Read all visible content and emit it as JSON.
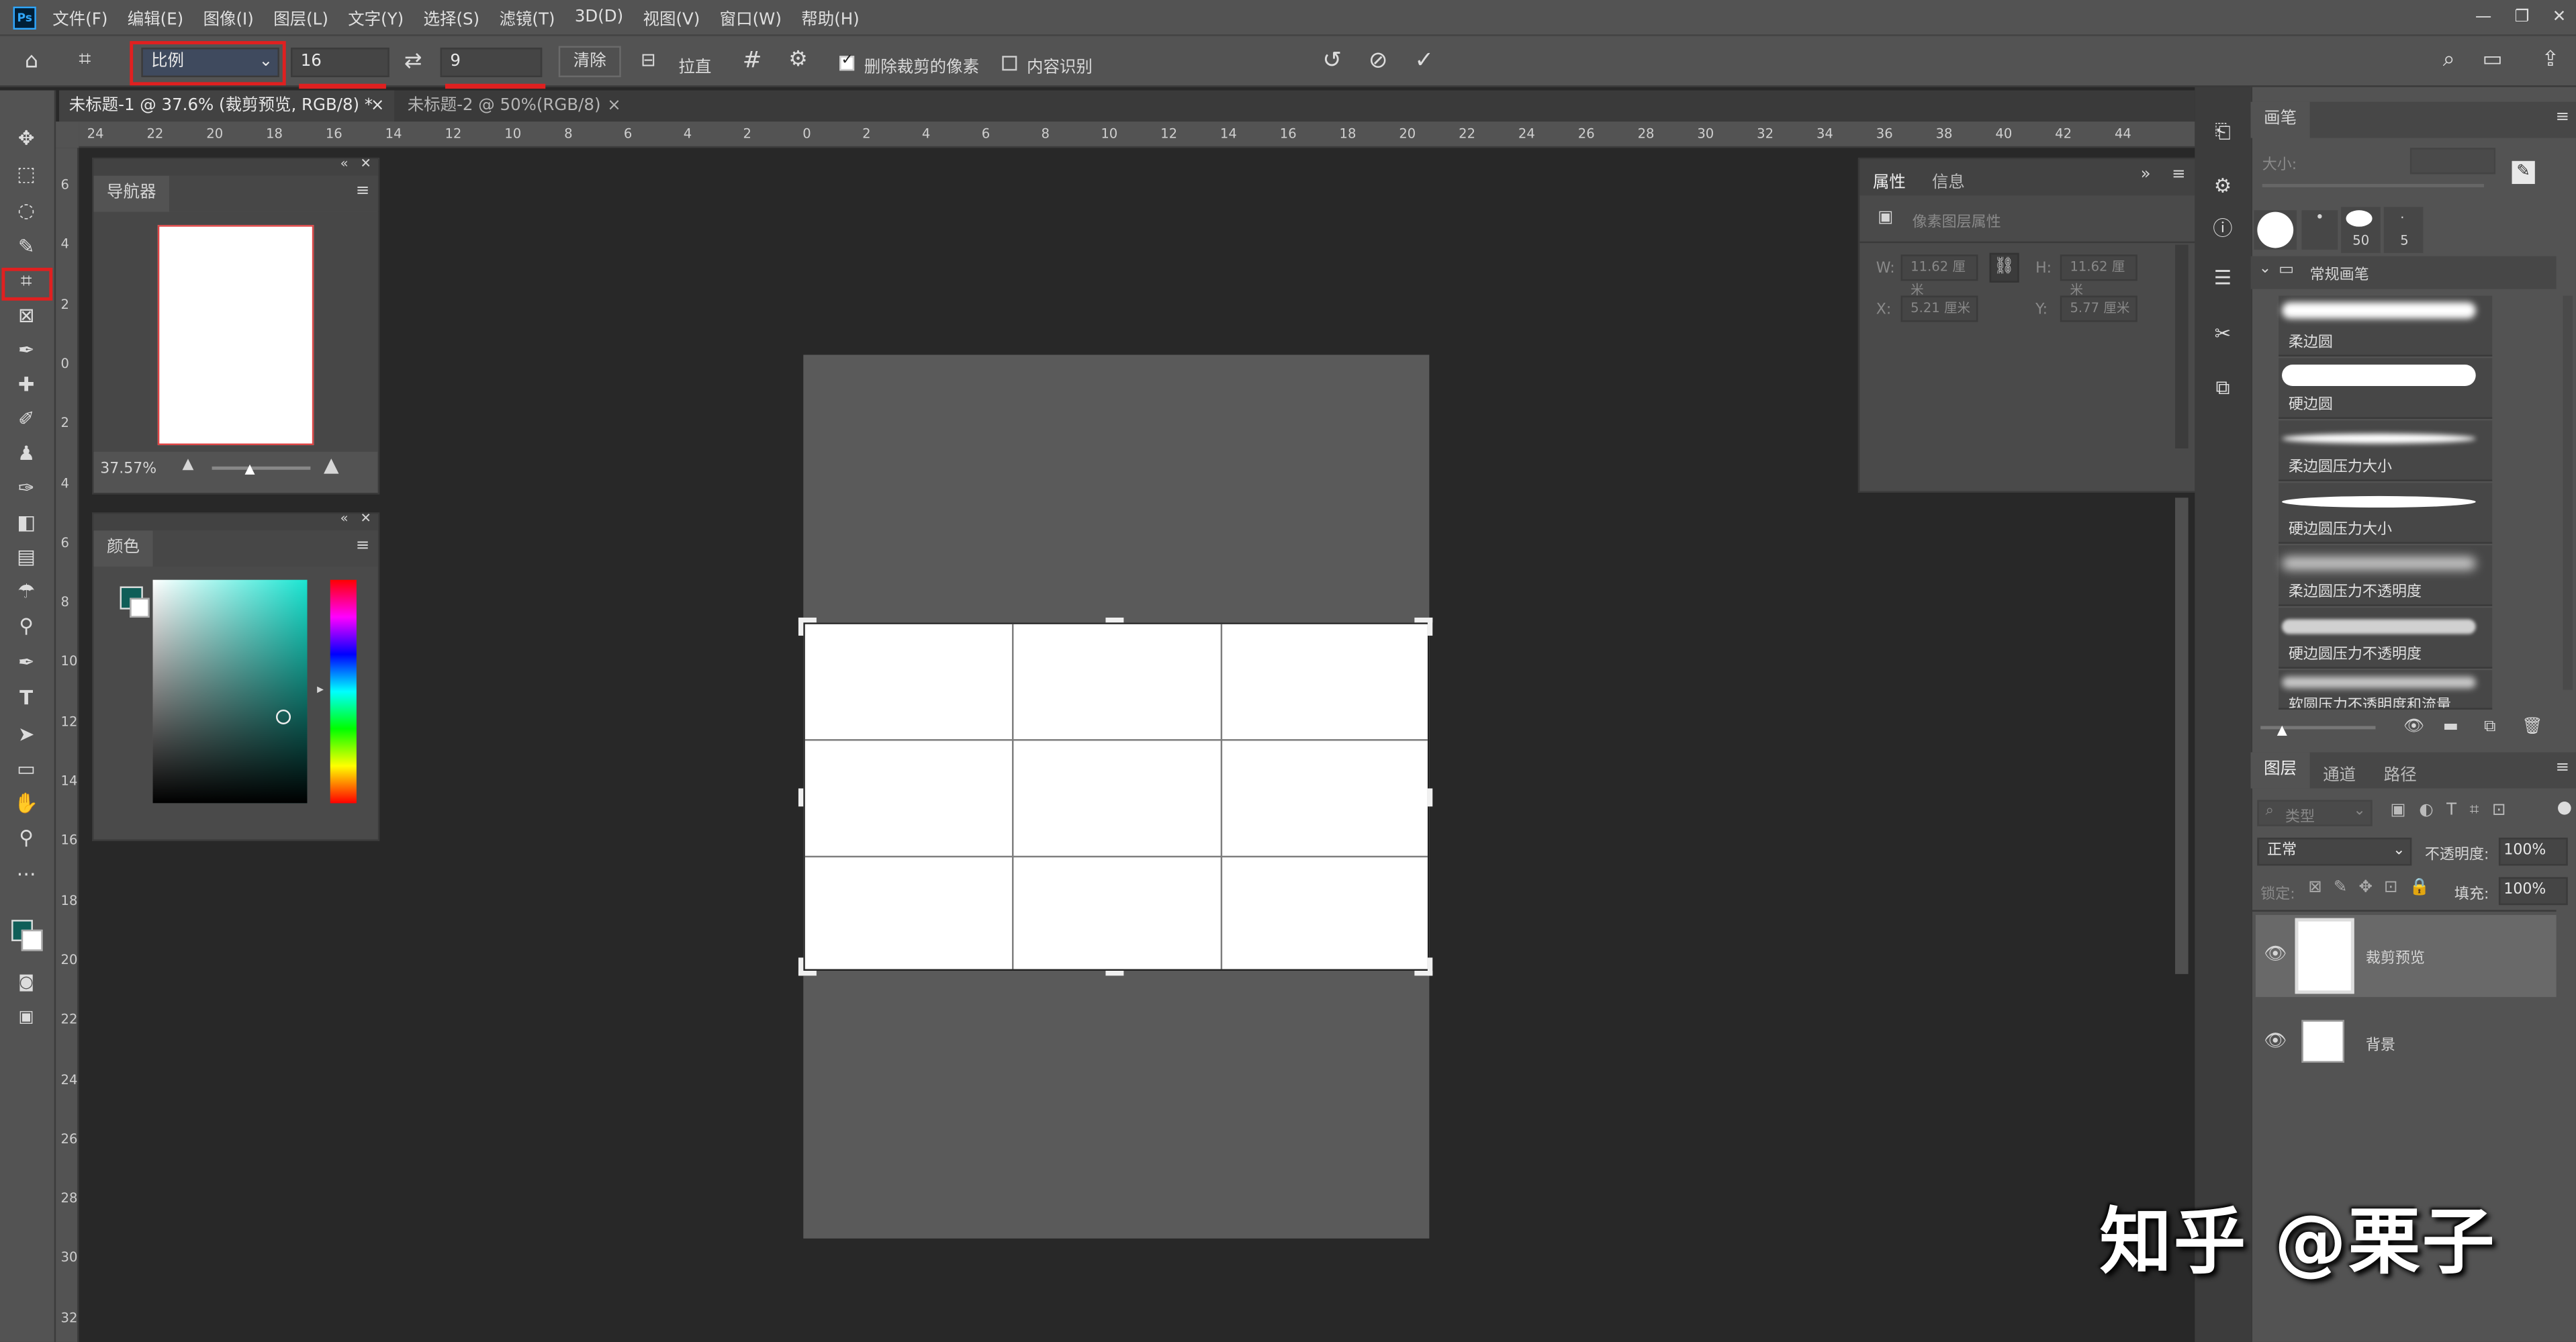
{
  "menu": {
    "logo": "Ps",
    "items": [
      "文件(F)",
      "编辑(E)",
      "图像(I)",
      "图层(L)",
      "文字(Y)",
      "选择(S)",
      "滤镜(T)",
      "3D(D)",
      "视图(V)",
      "窗口(W)",
      "帮助(H)"
    ],
    "window_controls": [
      "—",
      "❐",
      "✕"
    ]
  },
  "options": {
    "ratio_select": "比例",
    "width_value": "16",
    "height_value": "9",
    "clear_label": "清除",
    "straighten_label": "拉直",
    "delete_pixels_label": "删除裁剪的像素",
    "content_aware_label": "内容识别",
    "delete_pixels_checked": true,
    "content_aware_checked": false
  },
  "tabs": [
    {
      "label": "未标题-1 @ 37.6% (裁剪预览, RGB/8) *",
      "close": "×",
      "active": true
    },
    {
      "label": "未标题-2 @ 50%(RGB/8)",
      "close": "×",
      "active": false
    }
  ],
  "ruler_h": [
    "24",
    "22",
    "20",
    "18",
    "16",
    "14",
    "12",
    "10",
    "8",
    "6",
    "4",
    "2",
    "0",
    "2",
    "4",
    "6",
    "8",
    "10",
    "12",
    "14",
    "16",
    "18",
    "20",
    "22",
    "24",
    "26",
    "28",
    "30",
    "32",
    "34",
    "36",
    "38",
    "40",
    "42",
    "44"
  ],
  "ruler_v": [
    "6",
    "4",
    "2",
    "0",
    "2",
    "4",
    "6",
    "8",
    "10",
    "12",
    "14",
    "16",
    "18",
    "20",
    "22",
    "24",
    "26",
    "28",
    "30",
    "32"
  ],
  "navigator": {
    "title": "导航器",
    "zoom": "37.57%"
  },
  "color_panel": {
    "title": "颜色",
    "fg_color": "#0f5e58",
    "bg_color": "#ffffff"
  },
  "properties": {
    "tabs": [
      "属性",
      "信息"
    ],
    "section": "像素图层属性",
    "w_label": "W:",
    "w_value": "11.62 厘米",
    "h_label": "H:",
    "h_value": "11.62 厘米",
    "x_label": "X:",
    "x_value": "5.21 厘米",
    "y_label": "Y:",
    "y_value": "5.77 厘米"
  },
  "brush_panel": {
    "title": "画笔",
    "size_label": "大小:",
    "preset_sizes": [
      "50",
      "5"
    ],
    "group": "常规画笔",
    "brushes": [
      "柔边圆",
      "硬边圆",
      "柔边圆压力大小",
      "硬边圆压力大小",
      "柔边圆压力不透明度",
      "硬边圆压力不透明度",
      "软圆压力不透明度和流量"
    ]
  },
  "layers_panel": {
    "tabs": [
      "图层",
      "通道",
      "路径"
    ],
    "filter_label": "类型",
    "blend_mode": "正常",
    "opacity_label": "不透明度:",
    "opacity_value": "100%",
    "lock_label": "锁定:",
    "fill_label": "填充:",
    "fill_value": "100%",
    "layers": [
      {
        "name": "裁剪预览",
        "visible": true,
        "selected": true
      },
      {
        "name": "背景",
        "visible": true,
        "selected": false
      }
    ]
  },
  "watermark": "知乎 @栗子",
  "colors": {
    "crop_highlight": "#e02020",
    "ui_panel": "#535353",
    "canvas_bg": "#282828"
  }
}
